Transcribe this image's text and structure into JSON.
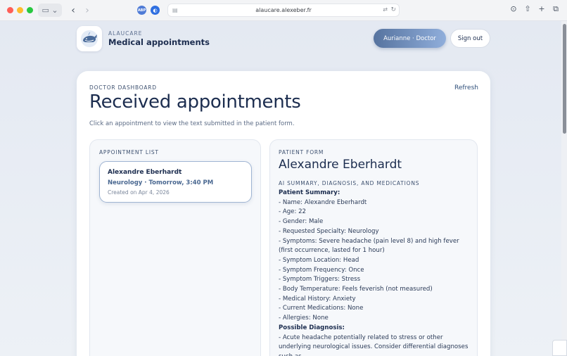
{
  "browser": {
    "url": "alaucare.alexeber.fr",
    "ext_badge": "ABP"
  },
  "brand": {
    "eyebrow": "ALAUCARE",
    "title": "Medical appointments"
  },
  "header": {
    "role_label": "Aurianne · Doctor",
    "signout_label": "Sign out"
  },
  "dashboard": {
    "eyebrow": "DOCTOR DASHBOARD",
    "refresh_label": "Refresh",
    "title": "Received appointments",
    "subtitle": "Click an appointment to view the text submitted in the patient form."
  },
  "appointment_list": {
    "eyebrow": "APPOINTMENT LIST",
    "items": [
      {
        "name": "Alexandre Eberhardt",
        "meta": "Neurology · Tomorrow, 3:40 PM",
        "created": "Created on Apr 4, 2026"
      }
    ]
  },
  "patient_form": {
    "eyebrow": "PATIENT FORM",
    "name": "Alexandre Eberhardt",
    "section_label": "AI SUMMARY, DIAGNOSIS, AND MEDICATIONS",
    "summary_heading": "Patient Summary:",
    "summary_lines": [
      "- Name: Alexandre Eberhardt",
      "- Age: 22",
      "- Gender: Male",
      "- Requested Specialty: Neurology",
      "- Symptoms: Severe headache (pain level 8) and high fever (first occurrence, lasted for 1 hour)",
      "- Symptom Location: Head",
      "- Symptom Frequency: Once",
      "- Symptom Triggers: Stress",
      "- Body Temperature: Feels feverish (not measured)",
      "- Medical History: Anxiety",
      "- Current Medications: None",
      "- Allergies: None"
    ],
    "diagnosis_heading": "Possible Diagnosis:",
    "diagnosis_lines": [
      "- Acute headache potentially related to stress or other underlying neurological issues. Consider differential diagnoses such as"
    ]
  },
  "colors": {
    "accent": "#56739f",
    "text_dark": "#1c2d4f",
    "panel_bg": "#f6f8fb"
  }
}
